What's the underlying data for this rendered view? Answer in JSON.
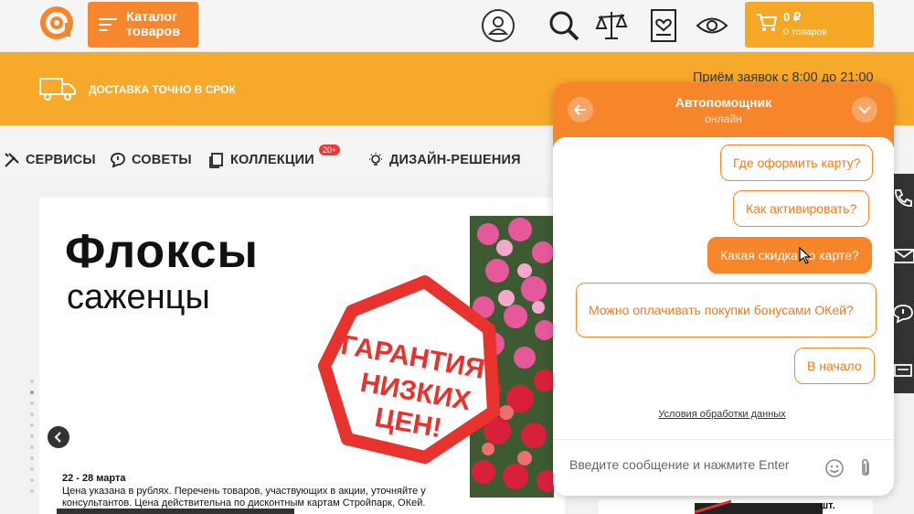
{
  "header": {
    "catalog_label": "Каталог\nтоваров",
    "cart": {
      "price": "0 ₽",
      "count": "0 товаров"
    },
    "icons": [
      "account-icon",
      "search-icon",
      "compare-scales-icon",
      "wishlist-icon",
      "viewed-icon",
      "cart-icon"
    ]
  },
  "banner": {
    "delivery": "ДОСТАВКА ТОЧНО В СРОК",
    "hours": "Приём заявок с 8:00 до 21:00"
  },
  "nav": {
    "items": [
      {
        "label": "СЕРВИСЫ",
        "icon": "tools-icon"
      },
      {
        "label": "СОВЕТЫ",
        "icon": "chat-bubble-icon"
      },
      {
        "label": "КОЛЛЕКЦИИ",
        "icon": "collection-icon"
      },
      {
        "label": "ДИЗАЙН-РЕШЕНИЯ",
        "icon": "lamp-icon"
      }
    ],
    "badge": "20+"
  },
  "promo": {
    "title": "Флоксы",
    "subtitle": "саженцы",
    "stamp_lines": [
      "ГАРАНТИЯ",
      "НИЗКИХ",
      "ЦЕН!"
    ],
    "dates": "22 - 28 марта",
    "note": "Цена указана в рублях. Перечень товаров, участвующих в акции, уточняйте у консультантов. Цена действительна по дисконтным картам Стройпарк, ОКей.",
    "price_unit": "шт."
  },
  "chat": {
    "title": "Автопомощник",
    "status": "онлайн",
    "quick_replies": [
      "Где оформить карту?",
      "Как активировать?",
      "Какая скидка по карте?",
      "Можно оплачивать покупки бонусами ОКей?",
      "В начало"
    ],
    "privacy": "Условия обработки данных",
    "input_placeholder": "Введите сообщение и нажмите Enter"
  },
  "colors": {
    "accent": "#f7862b",
    "banner": "#f6a92a",
    "stamp": "#e8322d"
  }
}
